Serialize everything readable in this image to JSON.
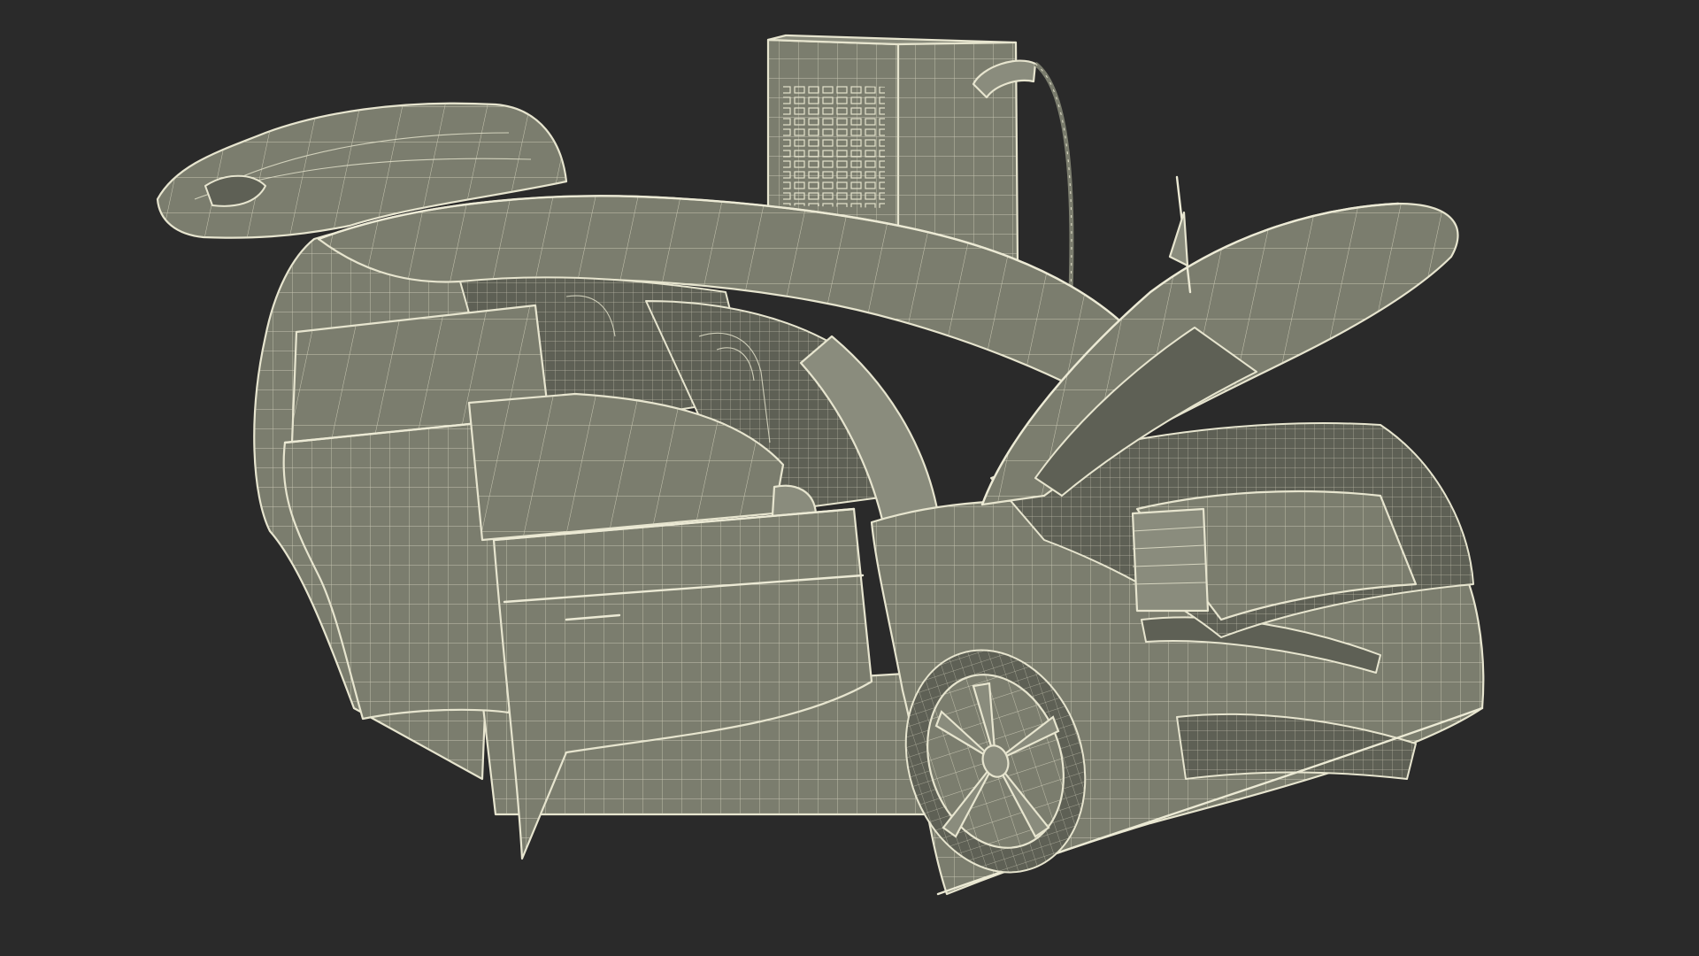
{
  "scene": {
    "background_color": "#2a2a2a",
    "surface_color": "#7b7d6e",
    "wire_color": "#e7e5cf",
    "objects": [
      "electric-suv-wireframe",
      "ev-charging-station",
      "open-frunk-hood",
      "open-rear-tailgate",
      "open-front-door",
      "open-rear-door",
      "front-wheel"
    ]
  }
}
